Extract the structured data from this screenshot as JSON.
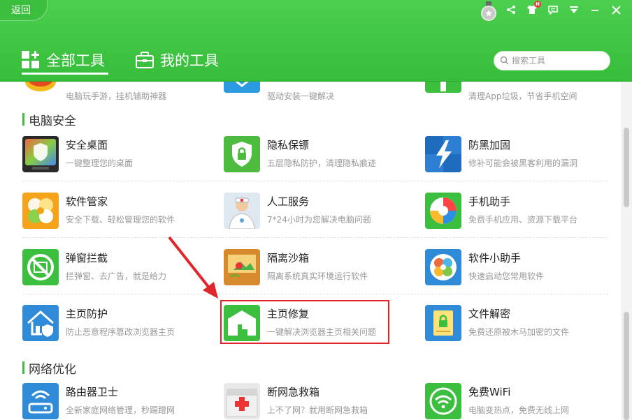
{
  "header": {
    "back_label": "返回",
    "tabs": [
      {
        "label": "全部工具",
        "active": true
      },
      {
        "label": "我的工具",
        "active": false
      }
    ],
    "search": {
      "placeholder": "搜索工具"
    },
    "notification_badge": "N",
    "accent_color": "#3cbe3f"
  },
  "top_partial": [
    {
      "desc": "电脑玩手游，挂机辅助神器"
    },
    {
      "desc": "驱动安装一键解决"
    },
    {
      "desc": "清理App垃圾，节省手机空间"
    }
  ],
  "sections": [
    {
      "title": "电脑安全",
      "tools": [
        {
          "name": "安全桌面",
          "desc": "一键整理您的桌面",
          "icon": "safe-desktop-icon"
        },
        {
          "name": "隐私保镖",
          "desc": "五层隐私防护，清理隐私痕迹",
          "icon": "privacy-lock-icon"
        },
        {
          "name": "防黑加固",
          "desc": "修补可能会被黑客利用的漏洞",
          "icon": "lightning-shield-icon"
        },
        {
          "name": "软件管家",
          "desc": "安全下载、轻松管理您的软件",
          "icon": "software-manager-icon"
        },
        {
          "name": "人工服务",
          "desc": "7*24小时为您解决电脑问题",
          "icon": "doctor-icon"
        },
        {
          "name": "手机助手",
          "desc": "免费手机应用、资源下载平台",
          "icon": "phone-assistant-icon"
        },
        {
          "name": "弹窗拦截",
          "desc": "拦弹窗、去广告，就是给力",
          "icon": "popup-block-icon"
        },
        {
          "name": "隔离沙箱",
          "desc": "隔离系统真实环境运行软件",
          "icon": "sandbox-icon"
        },
        {
          "name": "软件小助手",
          "desc": "快速启动您常用软件",
          "icon": "software-helper-icon"
        },
        {
          "name": "主页防护",
          "desc": "防止恶意程序篡改浏览器主页",
          "icon": "home-protect-icon"
        },
        {
          "name": "主页修复",
          "desc": "一键解决浏览器主页相关问题",
          "icon": "home-repair-icon"
        },
        {
          "name": "文件解密",
          "desc": "免费还原被木马加密的文件",
          "icon": "file-decrypt-icon"
        }
      ]
    },
    {
      "title": "网络优化",
      "tools": [
        {
          "name": "路由器卫士",
          "desc": "全新家庭网络管理，秒踢蹭网",
          "icon": "router-icon"
        },
        {
          "name": "断网急救箱",
          "desc": "上不了网？就用断网急救箱",
          "icon": "first-aid-icon"
        },
        {
          "name": "免费WiFi",
          "desc": "电脑变热点，免费无线上网",
          "icon": "wifi-icon"
        }
      ]
    }
  ]
}
